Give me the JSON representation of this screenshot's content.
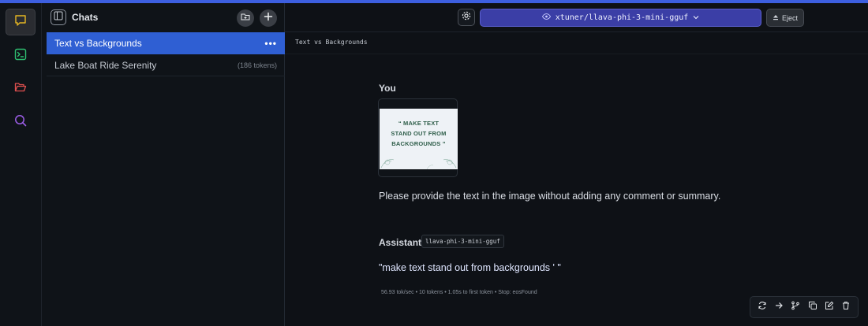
{
  "rail": {
    "items": [
      {
        "icon": "chat-icon",
        "active": true
      },
      {
        "icon": "terminal-icon",
        "active": false
      },
      {
        "icon": "folder-icon",
        "active": false
      },
      {
        "icon": "search-icon",
        "active": false
      }
    ]
  },
  "chats": {
    "title": "Chats",
    "list": [
      {
        "label": "Text vs Backgrounds",
        "selected": true,
        "menu": "•••"
      },
      {
        "label": "Lake Boat Ride Serenity",
        "selected": false,
        "meta": "(186 tokens)"
      }
    ]
  },
  "toolbar": {
    "model": "xtuner/llava-phi-3-mini-gguf",
    "eject_label": "Eject"
  },
  "conversation": {
    "title": "Text vs Backgrounds",
    "user": {
      "role": "You",
      "image_text": "“MAKE TEXT STAND OUT FROM BACKGROUNDS”",
      "image_line1": "“ MAKE TEXT",
      "image_line2": "STAND OUT FROM",
      "image_line3": "BACKGROUNDS ”",
      "prompt": "Please provide the text in the image without adding any comment or summary."
    },
    "assistant": {
      "role": "Assistant",
      "model_badge": "llava-phi-3-mini-gguf",
      "reply": "\"make text stand out from backgrounds ' \"",
      "stats": "56.93 tok/sec  •  10 tokens  •  1.05s to first token  •  Stop: eosFound"
    }
  },
  "colors": {
    "accent": "#3d5fe0",
    "selected": "#2f5fd3",
    "model_select": "#3b3ea6"
  }
}
